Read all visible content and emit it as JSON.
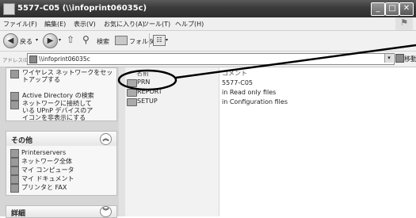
{
  "window": {
    "title": "5577-C05 (\\\\infoprint06035c)"
  },
  "menu": {
    "items": [
      "ファイル(F)",
      "編集(E)",
      "表示(V)",
      "お気に入り(A)",
      "ツール(T)",
      "ヘルプ(H)"
    ]
  },
  "toolbar": {
    "back_label": "戻る",
    "search_label": "検索",
    "folders_label": "フォルダ"
  },
  "address": {
    "label": "アドレス(D)",
    "value": "\\\\infoprint06035c",
    "go_label": "移動"
  },
  "left_pane": {
    "network_tasks": {
      "items": [
        "ワイヤレス ネットワークをセットアップする",
        "Active Directory の検索",
        "ネットワークに接続している UPnP デバイスのアイコンを非表示にする"
      ]
    },
    "other_places": {
      "title": "その他",
      "items": [
        "Printerservers",
        "ネットワーク全体",
        "マイ コンピュータ",
        "マイ ドキュメント",
        "プリンタと FAX"
      ]
    },
    "details": {
      "title": "詳細"
    }
  },
  "list": {
    "header": {
      "name": "名前",
      "comment": "コメント"
    },
    "rows": [
      {
        "name": "PRN",
        "comment": "5577-C05"
      },
      {
        "name": "REPORT",
        "comment": "in Read only files"
      },
      {
        "name": "SETUP",
        "comment": "in Configuration files"
      }
    ]
  }
}
